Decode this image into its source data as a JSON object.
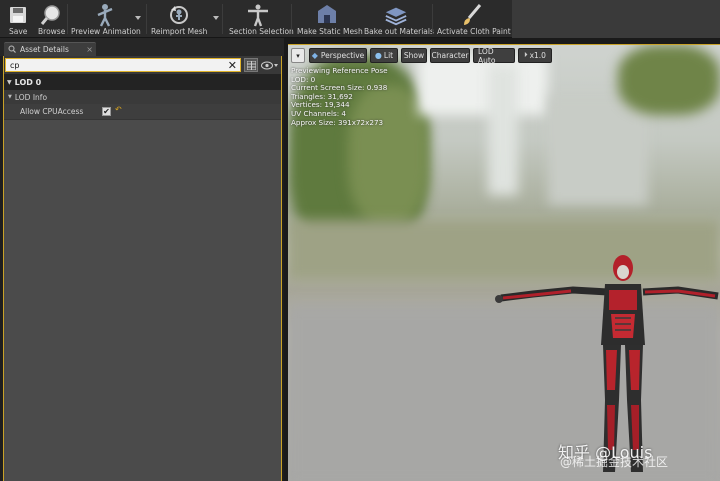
{
  "toolbar": {
    "save_label": "Save",
    "browse_label": "Browse",
    "preview_animation_label": "Preview Animation",
    "reimport_mesh_label": "Reimport Mesh",
    "section_selection_label": "Section Selection",
    "make_static_mesh_label": "Make Static Mesh",
    "bake_out_materials_label": "Bake out Materials",
    "activate_cloth_paint_label": "Activate Cloth Paint"
  },
  "details_panel": {
    "tab_title": "Asset Details",
    "search_value": "cp",
    "category": "LOD 0",
    "subcategory": "LOD Info",
    "property": {
      "name": "Allow CPUAccess",
      "checked": true,
      "check_glyph": "✔"
    }
  },
  "viewport": {
    "toolbar": {
      "perspective_label": "Perspective",
      "lit_label": "Lit",
      "show_label": "Show",
      "character_label": "Character",
      "lod_label": "LOD Auto",
      "speed_label": "x1.0"
    },
    "info_lines": {
      "line1": "Previewing Reference Pose",
      "line2": "LOD: 0",
      "line3": "Current Screen Size: 0.938",
      "line4": "Triangles: 31,692",
      "line5": "Vertices: 19,344",
      "line6": "UV Channels: 4",
      "line7": "Approx Size: 391x72x273"
    }
  },
  "watermark": {
    "main": "知乎 @Louis",
    "sub": "@稀土掘金技术社区"
  },
  "colors": {
    "accent_border": "#c9a227",
    "panel_bg": "#4a4a4a",
    "toolbar_bg": "#2b2b2b"
  }
}
